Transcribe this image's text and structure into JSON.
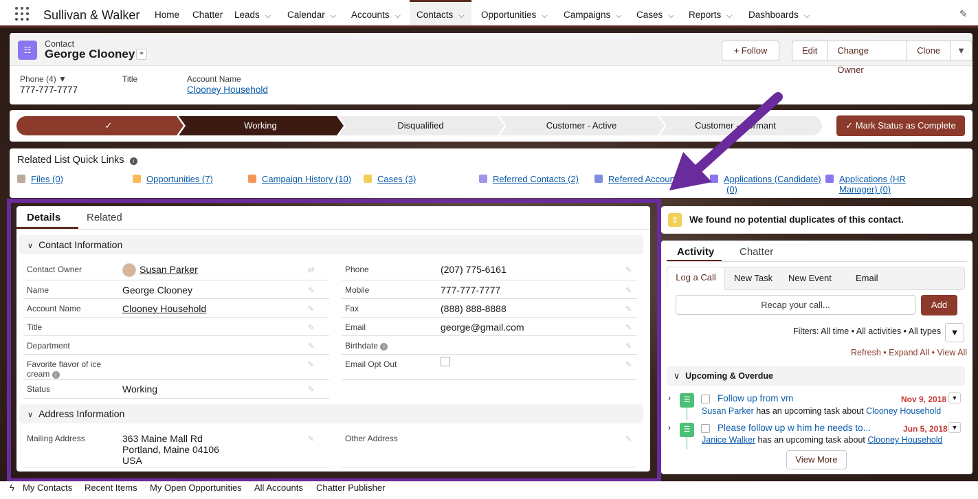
{
  "app": {
    "name": "Sullivan & Walker"
  },
  "nav": {
    "home": "Home",
    "chatter": "Chatter",
    "leads": "Leads",
    "calendar": "Calendar",
    "accounts": "Accounts",
    "contacts": "Contacts",
    "opportunities": "Opportunities",
    "campaigns": "Campaigns",
    "cases": "Cases",
    "reports": "Reports",
    "dashboards": "Dashboards"
  },
  "header": {
    "object": "Contact",
    "name": "George Clooney",
    "follow": "+ Follow",
    "edit": "Edit",
    "change_owner": "Change Owner",
    "clone": "Clone",
    "phone_label": "Phone (4) ▼",
    "phone_value": "777-777-7777",
    "title_label": "Title",
    "account_label": "Account Name",
    "account_value": "Clooney Household"
  },
  "path": {
    "step2": "Working",
    "step3": "Disqualified",
    "step4": "Customer - Active",
    "step5": "Customer - Dormant",
    "complete": "✓  Mark Status as Complete"
  },
  "quicklinks": {
    "title": "Related List Quick Links",
    "files": "Files (0)",
    "opps": "Opportunities (7)",
    "campaign": "Campaign History (10)",
    "cases": "Cases (3)",
    "refcontacts": "Referred Contacts (2)",
    "refaccounts": "Referred Accounts",
    "app_cand_1": "Applications (Candidate)",
    "app_cand_2": "(0)",
    "app_hr_1": "Applications (HR",
    "app_hr_2": "Manager) (0)"
  },
  "details": {
    "tab_details": "Details",
    "tab_related": "Related",
    "sec_contact": "Contact Information",
    "sec_address": "Address Information",
    "owner_label": "Contact Owner",
    "owner_value": "Susan Parker",
    "name_label": "Name",
    "name_value": "George Clooney",
    "acct_label": "Account Name",
    "acct_value": "Clooney Household",
    "title_label": "Title",
    "dept_label": "Department",
    "flavor_label_1": "Favorite flavor of ice",
    "flavor_label_2": "cream",
    "status_label": "Status",
    "status_value": "Working",
    "phone_label": "Phone",
    "phone_value": "(207) 775-6161",
    "mobile_label": "Mobile",
    "mobile_value": "777-777-7777",
    "fax_label": "Fax",
    "fax_value": "(888) 888-8888",
    "email_label": "Email",
    "email_value": "george@gmail.com",
    "birth_label": "Birthdate",
    "optout_label": "Email Opt Out",
    "mail_label": "Mailing Address",
    "mail_1": "363 Maine Mall Rd",
    "mail_2": "Portland, Maine 04106",
    "mail_3": "USA",
    "other_label": "Other Address"
  },
  "dup": {
    "text": "We found no potential duplicates of this contact."
  },
  "activity": {
    "tab_activity": "Activity",
    "tab_chatter": "Chatter",
    "log_call": "Log a Call",
    "new_task": "New Task",
    "new_event": "New Event",
    "email": "Email",
    "recap": "Recap your call...",
    "add": "Add",
    "filters": "Filters: All time • All activities • All types",
    "refresh": "Refresh",
    "expand": "Expand All",
    "view_all": "View All",
    "upcoming": "Upcoming & Overdue",
    "t1_title": "Follow up from vm",
    "t1_date": "Nov 9, 2018",
    "t1_who": "Susan Parker",
    "t1_mid": "has an upcoming task about",
    "t1_acct": "Clooney Household",
    "t2_title": "Please follow up w him he needs to...",
    "t2_date": "Jun 5, 2018",
    "t2_who": "Janice Walker",
    "t2_mid": "has an upcoming task about",
    "t2_acct": "Clooney Household",
    "view_more": "View More"
  },
  "footer": {
    "my_contacts": "My Contacts",
    "recent": "Recent Items",
    "my_opps": "My Open Opportunities",
    "all_accounts": "All Accounts",
    "publisher": "Chatter Publisher"
  },
  "colors": {
    "brand": "#5b2a20",
    "highlight": "#6a2c9c",
    "link": "#0b5cab"
  }
}
